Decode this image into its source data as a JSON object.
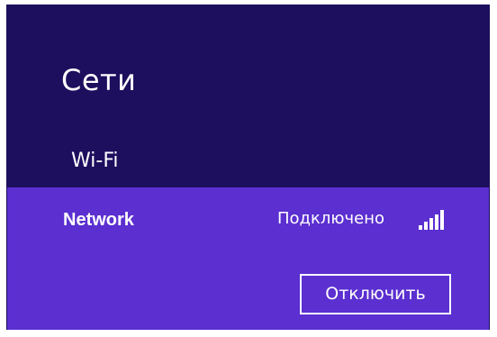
{
  "panel": {
    "title": "Сети",
    "section_label": "Wi-Fi"
  },
  "network": {
    "name": "Network",
    "status": "Подключено",
    "signal_icon": "wifi-signal-bars-icon",
    "disconnect_label": "Отключить"
  },
  "colors": {
    "header_background": "#1d0e5e",
    "selected_background": "#5b2fd0",
    "text": "#ffffff"
  }
}
